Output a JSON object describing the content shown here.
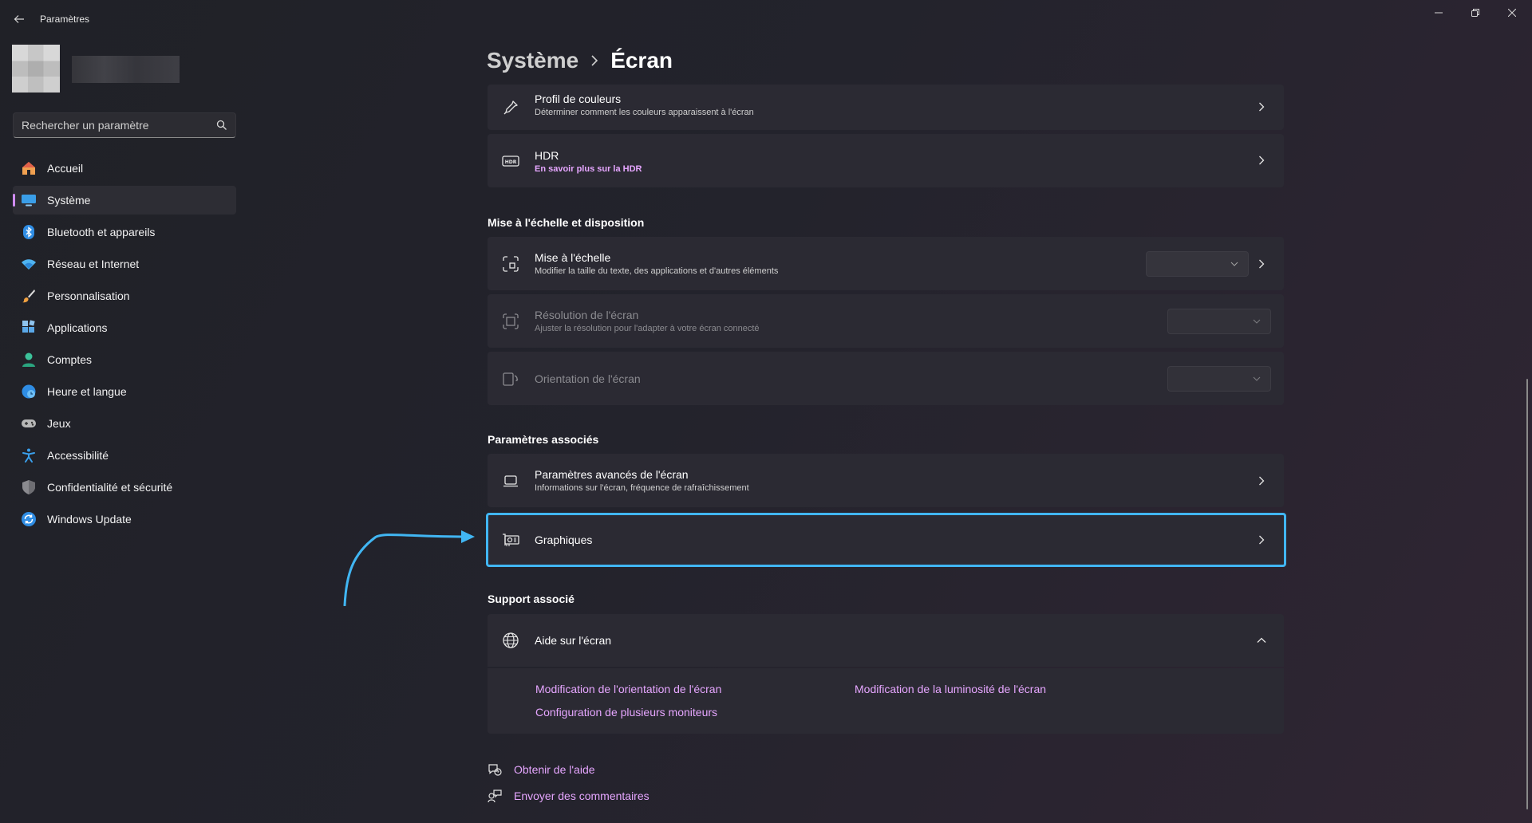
{
  "window": {
    "title": "Paramètres",
    "controls": [
      "minimize-icon",
      "restore-icon",
      "close-icon"
    ]
  },
  "search": {
    "placeholder": "Rechercher un paramètre"
  },
  "sidebar": {
    "items": [
      {
        "label": "Accueil",
        "icon": "home-icon"
      },
      {
        "label": "Système",
        "icon": "monitor-icon",
        "active": true
      },
      {
        "label": "Bluetooth et appareils",
        "icon": "bluetooth-icon"
      },
      {
        "label": "Réseau et Internet",
        "icon": "wifi-icon"
      },
      {
        "label": "Personnalisation",
        "icon": "brush-icon"
      },
      {
        "label": "Applications",
        "icon": "apps-icon"
      },
      {
        "label": "Comptes",
        "icon": "person-icon"
      },
      {
        "label": "Heure et langue",
        "icon": "globe-clock-icon"
      },
      {
        "label": "Jeux",
        "icon": "gamepad-icon"
      },
      {
        "label": "Accessibilité",
        "icon": "accessibility-icon"
      },
      {
        "label": "Confidentialité et sécurité",
        "icon": "shield-icon"
      },
      {
        "label": "Windows Update",
        "icon": "update-icon"
      }
    ]
  },
  "breadcrumb": {
    "parent": "Système",
    "current": "Écran"
  },
  "cards": {
    "color_profile": {
      "title": "Profil de couleurs",
      "subtitle": "Déterminer comment les couleurs apparaissent à l'écran"
    },
    "hdr": {
      "title": "HDR",
      "subtitle": "En savoir plus sur la HDR"
    },
    "scale": {
      "title": "Mise à l'échelle",
      "subtitle": "Modifier la taille du texte, des applications et d'autres éléments"
    },
    "resolution": {
      "title": "Résolution de l'écran",
      "subtitle": "Ajuster la résolution pour l'adapter à  votre  écran connecté"
    },
    "orientation": {
      "title": "Orientation de l'écran"
    },
    "advanced": {
      "title": "Paramètres avancés de l'écran",
      "subtitle": "Informations sur l'écran, fréquence de rafraîchissement"
    },
    "graphics": {
      "title": "Graphiques"
    },
    "help": {
      "title": "Aide sur l'écran"
    }
  },
  "sections": {
    "scale_layout": "Mise à l'échelle et disposition",
    "related": "Paramètres associés",
    "support": "Support associé"
  },
  "help_links": [
    "Modification de l'orientation de l'écran",
    "Modification de la luminosité de l'écran",
    "Configuration de plusieurs moniteurs"
  ],
  "footer": {
    "get_help": "Obtenir de l'aide",
    "feedback": "Envoyer des commentaires"
  },
  "colors": {
    "accent": "#e6a6ff",
    "highlight": "#41b6f3"
  }
}
